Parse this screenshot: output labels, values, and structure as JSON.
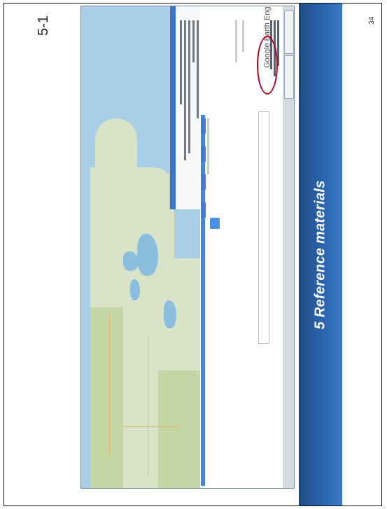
{
  "slide": {
    "title": "5 Reference materials",
    "label": "5-1",
    "page_number": "34"
  },
  "screenshot": {
    "app_title": "Google Earth Engine"
  },
  "colors": {
    "band": "#2b64ad",
    "highlight": "#b3001b",
    "water": "#a9cfe6",
    "land": "#d8e3c8"
  }
}
